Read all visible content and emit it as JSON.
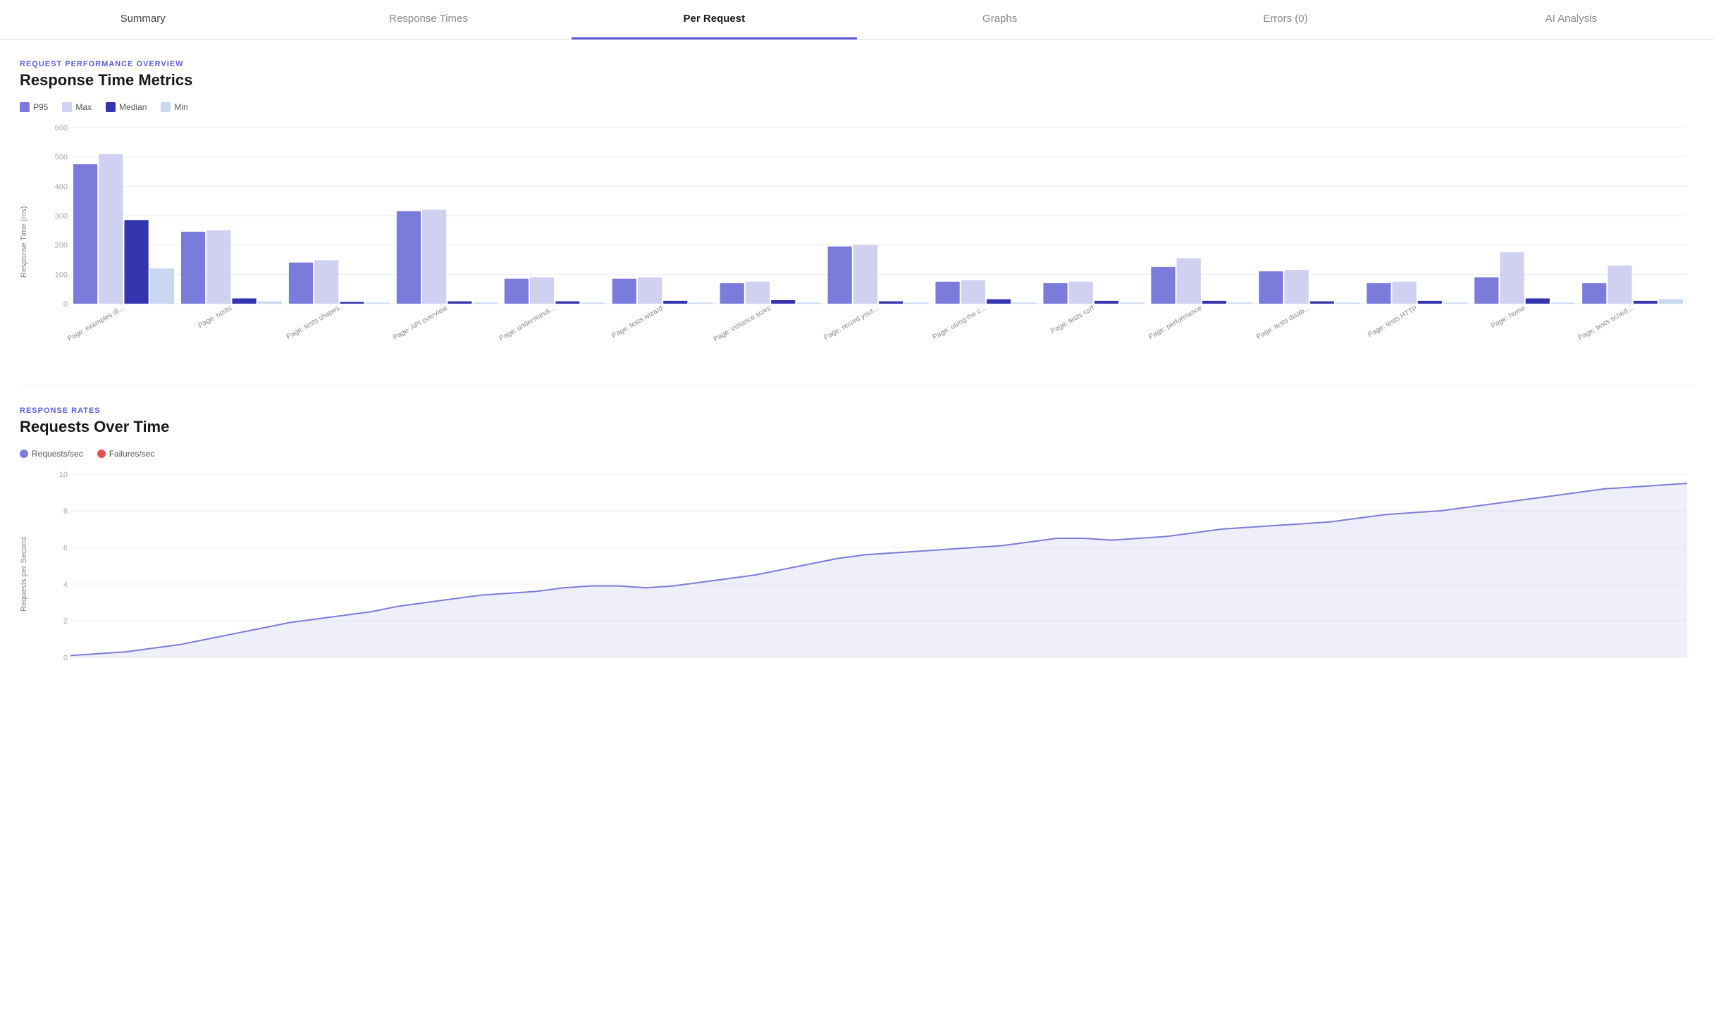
{
  "tabs": [
    {
      "id": "summary",
      "label": "Summary",
      "active": false
    },
    {
      "id": "response-times",
      "label": "Response Times",
      "active": false
    },
    {
      "id": "per-request",
      "label": "Per Request",
      "active": true
    },
    {
      "id": "graphs",
      "label": "Graphs",
      "active": false
    },
    {
      "id": "errors",
      "label": "Errors (0)",
      "active": false
    },
    {
      "id": "ai-analysis",
      "label": "AI Analysis",
      "active": false
    }
  ],
  "section1": {
    "label": "REQUEST PERFORMANCE OVERVIEW",
    "title": "Response Time Metrics",
    "legend": [
      {
        "key": "p95",
        "label": "P95",
        "color": "#7b7bdb"
      },
      {
        "key": "max",
        "label": "Max",
        "color": "#d0d0f0"
      },
      {
        "key": "median",
        "label": "Median",
        "color": "#3535b0"
      },
      {
        "key": "min",
        "label": "Min",
        "color": "#c8d8f0"
      }
    ],
    "y_axis_label": "Response Time (ms)",
    "y_ticks": [
      600,
      500,
      400,
      300,
      200,
      100,
      0
    ],
    "bar_groups": [
      {
        "label": "Page: examples di...",
        "p95": 475,
        "max": 510,
        "median": 285,
        "min": 120
      },
      {
        "label": "Page: hosts",
        "p95": 245,
        "max": 250,
        "median": 18,
        "min": 8
      },
      {
        "label": "Page: tests shapes",
        "p95": 140,
        "max": 148,
        "median": 6,
        "min": 4
      },
      {
        "label": "Page: API overview",
        "p95": 315,
        "max": 320,
        "median": 8,
        "min": 4
      },
      {
        "label": "Page: understandi...",
        "p95": 85,
        "max": 90,
        "median": 8,
        "min": 4
      },
      {
        "label": "Page: tests wizard",
        "p95": 85,
        "max": 90,
        "median": 10,
        "min": 4
      },
      {
        "label": "Page: instance sizes",
        "p95": 70,
        "max": 75,
        "median": 12,
        "min": 4
      },
      {
        "label": "Page: record your...",
        "p95": 195,
        "max": 200,
        "median": 8,
        "min": 4
      },
      {
        "label": "Page: using the c...",
        "p95": 75,
        "max": 80,
        "median": 15,
        "min": 4
      },
      {
        "label": "Page: tests csrf",
        "p95": 70,
        "max": 75,
        "median": 10,
        "min": 4
      },
      {
        "label": "Page: performance",
        "p95": 125,
        "max": 155,
        "median": 10,
        "min": 4
      },
      {
        "label": "Page: tests disab...",
        "p95": 110,
        "max": 115,
        "median": 8,
        "min": 4
      },
      {
        "label": "Page: tests HTTP",
        "p95": 70,
        "max": 75,
        "median": 10,
        "min": 4
      },
      {
        "label": "Page: home",
        "p95": 90,
        "max": 175,
        "median": 18,
        "min": 4
      },
      {
        "label": "Page: tests sched...",
        "p95": 70,
        "max": 130,
        "median": 10,
        "min": 15
      }
    ]
  },
  "section2": {
    "label": "RESPONSE RATES",
    "title": "Requests Over Time",
    "legend": [
      {
        "key": "requests",
        "label": "Requests/sec",
        "color": "#7b7bdb"
      },
      {
        "key": "failures",
        "label": "Failures/sec",
        "color": "#e05252"
      }
    ],
    "y_axis_label": "Requests per Second",
    "y_ticks": [
      10,
      8,
      6,
      4,
      2
    ],
    "line_data": [
      0.1,
      0.2,
      0.3,
      0.5,
      0.7,
      1.0,
      1.3,
      1.6,
      1.9,
      2.1,
      2.3,
      2.5,
      2.8,
      3.0,
      3.2,
      3.4,
      3.5,
      3.6,
      3.8,
      3.9,
      3.9,
      3.8,
      3.9,
      4.1,
      4.3,
      4.5,
      4.8,
      5.1,
      5.4,
      5.6,
      5.7,
      5.8,
      5.9,
      6.0,
      6.1,
      6.3,
      6.5,
      6.5,
      6.4,
      6.5,
      6.6,
      6.8,
      7.0,
      7.1,
      7.2,
      7.3,
      7.4,
      7.6,
      7.8,
      7.9,
      8.0,
      8.2,
      8.4,
      8.6,
      8.8,
      9.0,
      9.2,
      9.3,
      9.4,
      9.5
    ]
  },
  "colors": {
    "p95": "#7b7bdb",
    "max": "#d0d0f0",
    "median": "#3535b0",
    "min": "#c8d8f0",
    "accent": "#5c5ce0",
    "requests_line": "#7b7bdb",
    "failures_dot": "#e05252"
  }
}
